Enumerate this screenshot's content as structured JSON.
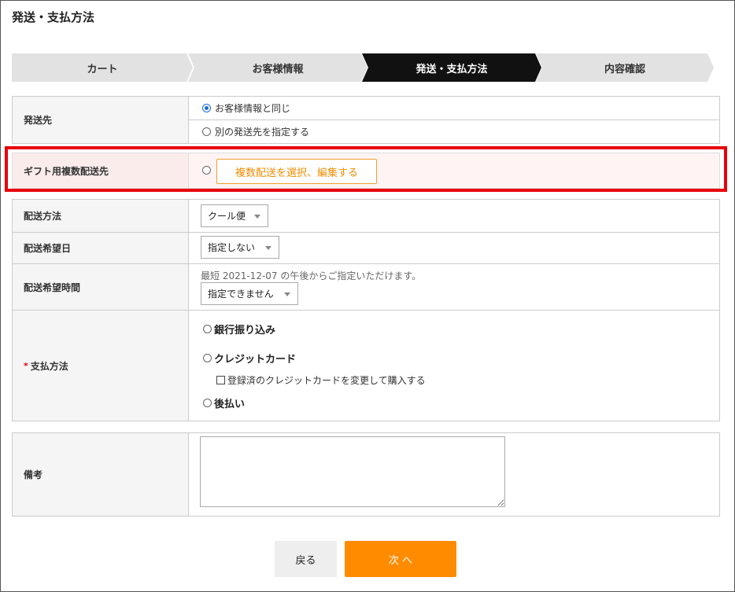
{
  "page": {
    "title": "発送・支払方法"
  },
  "steps": [
    {
      "label": "カート",
      "active": false
    },
    {
      "label": "お客様情報",
      "active": false
    },
    {
      "label": "発送・支払方法",
      "active": true
    },
    {
      "label": "内容確認",
      "active": false
    }
  ],
  "shipping_to": {
    "label": "発送先",
    "options": [
      {
        "label": "お客様情報と同じ",
        "checked": true
      },
      {
        "label": "別の発送先を指定する",
        "checked": false
      }
    ]
  },
  "gift": {
    "label": "ギフト用複数配送先",
    "button_label": "複数配送を選択、編集する"
  },
  "delivery": {
    "method_label": "配送方法",
    "method_value": "クール便",
    "date_label": "配送希望日",
    "date_value": "指定しない",
    "time_label": "配送希望時間",
    "time_note": "最短 2021-12-07 の午後からご指定いただけます。",
    "time_value": "指定できません"
  },
  "payment": {
    "required_mark": "*",
    "label": "支払方法",
    "options": {
      "bank": "銀行振り込み",
      "credit": "クレジットカード",
      "credit_change": "登録済のクレジットカードを変更して購入する",
      "deferred": "後払い"
    }
  },
  "remarks": {
    "label": "備考",
    "value": ""
  },
  "buttons": {
    "back": "戻る",
    "next": "次 へ"
  },
  "colors": {
    "accent": "#ff8c00",
    "highlight": "#e8000b",
    "active_step": "#111111"
  }
}
